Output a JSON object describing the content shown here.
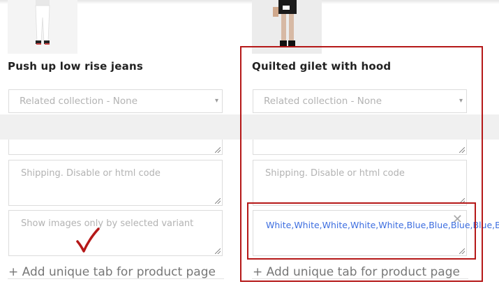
{
  "products": [
    {
      "title": "Push up low rise jeans",
      "related_collection": "Related collection - None",
      "shipping_placeholder": "Shipping. Disable or html code",
      "variant_images_placeholder": "Show images only by selected variant",
      "add_tab_label": "+ Add unique tab for product page"
    },
    {
      "title": "Quilted gilet with hood",
      "related_collection": "Related collection - None",
      "shipping_placeholder": "Shipping. Disable or html code",
      "variant_images_value": "White,White,White,White,White,Blue,Blue,Blue,Blue,Blue",
      "add_tab_label": "+ Add unique tab for product page"
    }
  ],
  "icons": {
    "select_caret": "▾",
    "clear": "✕"
  },
  "colors": {
    "annotation_red": "#b51818",
    "tag_blue": "#3d6ee0"
  }
}
